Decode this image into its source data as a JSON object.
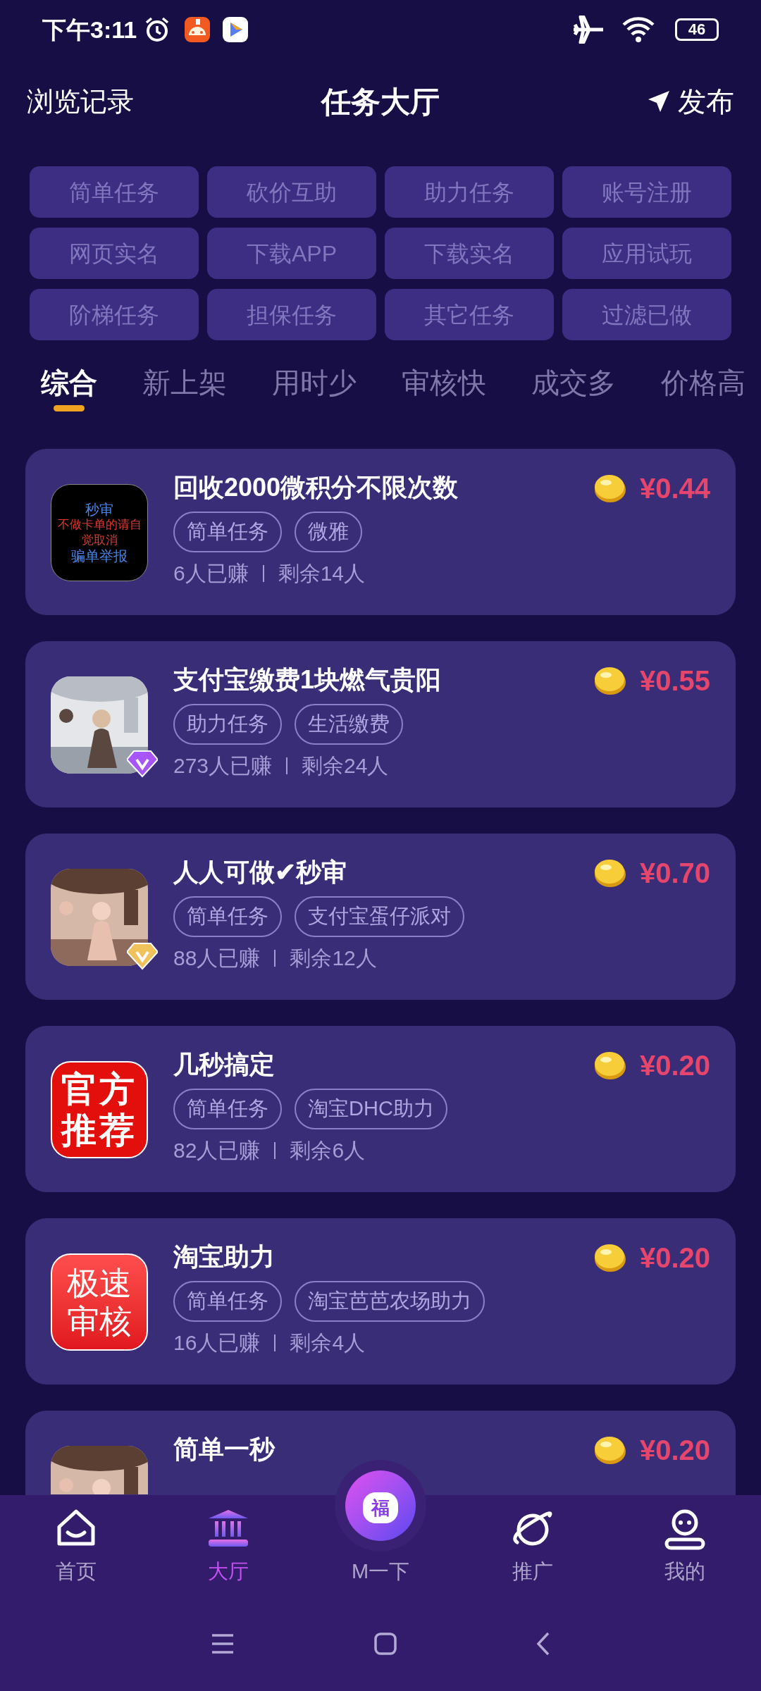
{
  "status_bar": {
    "time": "下午3:11",
    "battery": "46"
  },
  "header": {
    "left": "浏览记录",
    "title": "任务大厅",
    "right": "发布"
  },
  "filters": [
    "简单任务",
    "砍价互助",
    "助力任务",
    "账号注册",
    "网页实名",
    "下载APP",
    "下载实名",
    "应用试玩",
    "阶梯任务",
    "担保任务",
    "其它任务",
    "过滤已做"
  ],
  "sort_tabs": [
    {
      "label": "综合",
      "selected": true
    },
    {
      "label": "新上架",
      "selected": false
    },
    {
      "label": "用时少",
      "selected": false
    },
    {
      "label": "审核快",
      "selected": false
    },
    {
      "label": "成交多",
      "selected": false
    },
    {
      "label": "价格高",
      "selected": false
    }
  ],
  "tasks": [
    {
      "title": "回收2000微积分不限次数",
      "tags": [
        "简单任务",
        "微雅"
      ],
      "earned": "6人已赚",
      "remaining": "剩余14人",
      "price": "¥0.44",
      "icon": {
        "kind": "text",
        "lines": [
          {
            "text": "秒审",
            "color": "#4a86e8"
          },
          {
            "text": "不做卡单的请自",
            "color": "#e0392f"
          },
          {
            "text": "觉取消",
            "color": "#e0392f"
          },
          {
            "text": "骗单举报",
            "color": "#4a86e8"
          }
        ]
      }
    },
    {
      "title": "支付宝缴费1块燃气贵阳",
      "tags": [
        "助力任务",
        "生活缴费"
      ],
      "earned": "273人已赚",
      "remaining": "剩余24人",
      "price": "¥0.55",
      "icon": {
        "kind": "picture",
        "badge": {
          "color": "#a855f7"
        }
      }
    },
    {
      "title": "人人可做✔秒审",
      "tags": [
        "简单任务",
        "支付宝蛋仔派对"
      ],
      "earned": "88人已赚",
      "remaining": "剩余12人",
      "price": "¥0.70",
      "icon": {
        "kind": "picture",
        "badge": {
          "color": "#f2c25a"
        }
      }
    },
    {
      "title": "几秒搞定",
      "tags": [
        "简单任务",
        "淘宝DHC助力"
      ],
      "earned": "82人已赚",
      "remaining": "剩余6人",
      "price": "¥0.20",
      "icon": {
        "kind": "stamp",
        "lines": [
          "官方",
          "推荐"
        ]
      }
    },
    {
      "title": "淘宝助力",
      "tags": [
        "简单任务",
        "淘宝芭芭农场助力"
      ],
      "earned": "16人已赚",
      "remaining": "剩余4人",
      "price": "¥0.20",
      "icon": {
        "kind": "gradient",
        "lines": [
          "极速",
          "审核"
        ]
      }
    },
    {
      "title": "简单一秒",
      "price": "¥0.20"
    }
  ],
  "nav": [
    {
      "label": "首页",
      "kind": "home",
      "selected": false
    },
    {
      "label": "大厅",
      "kind": "hall",
      "selected": true
    },
    {
      "label": "M一下",
      "kind": "center",
      "icon_text": "福",
      "selected": false
    },
    {
      "label": "推广",
      "kind": "planet",
      "selected": false
    },
    {
      "label": "我的",
      "kind": "person",
      "selected": false
    }
  ]
}
